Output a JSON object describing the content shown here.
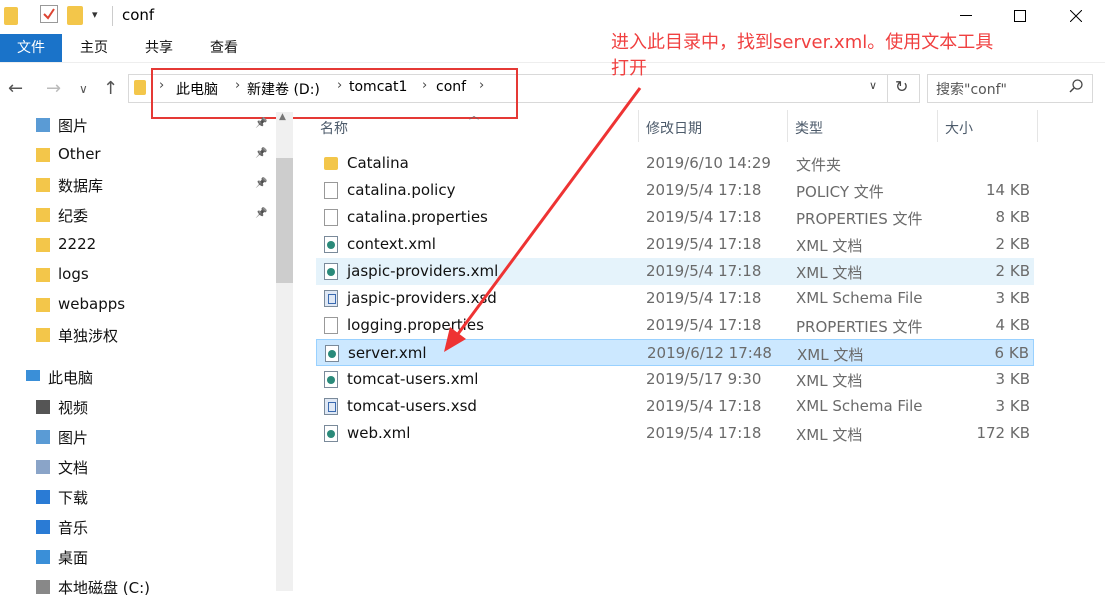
{
  "window": {
    "title": "conf"
  },
  "ribbon": {
    "tabs": [
      "文件",
      "主页",
      "共享",
      "查看"
    ]
  },
  "address": {
    "crumbs": [
      "此电脑",
      "新建卷 (D:)",
      "tomcat1",
      "conf"
    ],
    "search_placeholder": "搜索\"conf\""
  },
  "annotation": {
    "line1": "进入此目录中，找到server.xml。使用文本工具",
    "line2": "打开",
    "color": "#f04040"
  },
  "sidebar": {
    "quick": [
      {
        "label": "图片",
        "icon": "pictures-icon",
        "pinned": true
      },
      {
        "label": "Other",
        "icon": "folder-icon",
        "pinned": true
      },
      {
        "label": "数据库",
        "icon": "folder-icon",
        "pinned": true
      },
      {
        "label": "纪委",
        "icon": "folder-icon",
        "pinned": true
      },
      {
        "label": "2222",
        "icon": "folder-icon",
        "pinned": false
      },
      {
        "label": "logs",
        "icon": "folder-icon",
        "pinned": false
      },
      {
        "label": "webapps",
        "icon": "folder-icon",
        "pinned": false
      },
      {
        "label": "单独涉权",
        "icon": "folder-icon",
        "pinned": false
      }
    ],
    "this_pc": "此电脑",
    "pc_items": [
      {
        "label": "视频",
        "icon": "videos-icon"
      },
      {
        "label": "图片",
        "icon": "pictures-icon"
      },
      {
        "label": "文档",
        "icon": "documents-icon"
      },
      {
        "label": "下载",
        "icon": "downloads-icon"
      },
      {
        "label": "音乐",
        "icon": "music-icon"
      },
      {
        "label": "桌面",
        "icon": "desktop-icon"
      },
      {
        "label": "本地磁盘 (C:)",
        "icon": "drive-icon"
      }
    ]
  },
  "columns": {
    "name": "名称",
    "date": "修改日期",
    "type": "类型",
    "size": "大小"
  },
  "files": [
    {
      "name": "Catalina",
      "date": "2019/6/10 14:29",
      "type": "文件夹",
      "size": "",
      "icon": "folder"
    },
    {
      "name": "catalina.policy",
      "date": "2019/5/4 17:18",
      "type": "POLICY 文件",
      "size": "14 KB",
      "icon": "file"
    },
    {
      "name": "catalina.properties",
      "date": "2019/5/4 17:18",
      "type": "PROPERTIES 文件",
      "size": "8 KB",
      "icon": "file"
    },
    {
      "name": "context.xml",
      "date": "2019/5/4 17:18",
      "type": "XML 文档",
      "size": "2 KB",
      "icon": "xml"
    },
    {
      "name": "jaspic-providers.xml",
      "date": "2019/5/4 17:18",
      "type": "XML 文档",
      "size": "2 KB",
      "icon": "xml",
      "state": "hover"
    },
    {
      "name": "jaspic-providers.xsd",
      "date": "2019/5/4 17:18",
      "type": "XML Schema File",
      "size": "3 KB",
      "icon": "xsd"
    },
    {
      "name": "logging.properties",
      "date": "2019/5/4 17:18",
      "type": "PROPERTIES 文件",
      "size": "4 KB",
      "icon": "file"
    },
    {
      "name": "server.xml",
      "date": "2019/6/12 17:48",
      "type": "XML 文档",
      "size": "6 KB",
      "icon": "xml",
      "state": "selected"
    },
    {
      "name": "tomcat-users.xml",
      "date": "2019/5/17 9:30",
      "type": "XML 文档",
      "size": "3 KB",
      "icon": "xml"
    },
    {
      "name": "tomcat-users.xsd",
      "date": "2019/5/4 17:18",
      "type": "XML Schema File",
      "size": "3 KB",
      "icon": "xsd"
    },
    {
      "name": "web.xml",
      "date": "2019/5/4 17:18",
      "type": "XML 文档",
      "size": "172 KB",
      "icon": "xml"
    }
  ]
}
